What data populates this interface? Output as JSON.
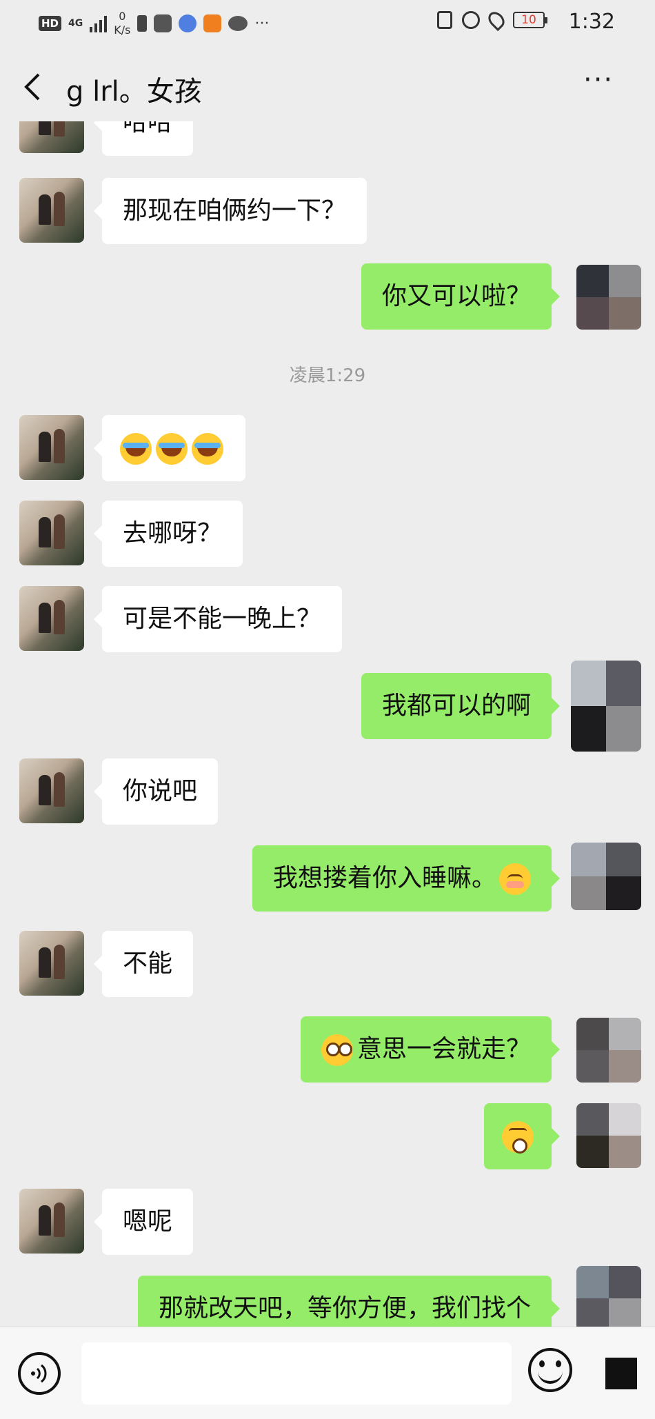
{
  "status_bar": {
    "hd": "HD",
    "network": "4G",
    "speed_value": "0",
    "speed_unit": "K/s",
    "battery": "10",
    "time": "1:32",
    "icons": [
      "sim-icon",
      "huawei-app-icon",
      "music-icon",
      "video-icon",
      "chat-bubble-icon",
      "more-dots-icon",
      "nfc-icon",
      "alarm-icon",
      "location-icon",
      "battery-icon"
    ]
  },
  "nav": {
    "title": "g lrl。女孩",
    "more": "···"
  },
  "chat": {
    "timestamp": "凌晨1:29",
    "messages": [
      {
        "side": "left",
        "text": "哈哈"
      },
      {
        "side": "left",
        "text": "那现在咱俩约一下？"
      },
      {
        "side": "right",
        "text": "你又可以啦？"
      },
      {
        "side": "left",
        "emoji": "loudly-crying-face x3"
      },
      {
        "side": "left",
        "text": "去哪呀？"
      },
      {
        "side": "left",
        "text": "可是不能一晚上？"
      },
      {
        "side": "right",
        "text": "我都可以的啊"
      },
      {
        "side": "left",
        "text": "你说吧"
      },
      {
        "side": "right",
        "text": "我想搂着你入睡嘛。",
        "emoji": "shy-face"
      },
      {
        "side": "left",
        "text": "不能"
      },
      {
        "side": "right",
        "text": "意思一会就走？",
        "emoji": "staring-face"
      },
      {
        "side": "right",
        "emoji": "surprised-face"
      },
      {
        "side": "left",
        "text": "嗯呢"
      },
      {
        "side": "right",
        "text": "那就改天吧，等你方便，我们找个"
      }
    ]
  },
  "input_bar": {
    "voice_icon": "voice-icon",
    "emoji_icon": "emoji-icon",
    "plus_icon": "more-input-icon"
  },
  "colors": {
    "background": "#ededed",
    "bubble_left": "#ffffff",
    "bubble_right": "#95ec69"
  }
}
